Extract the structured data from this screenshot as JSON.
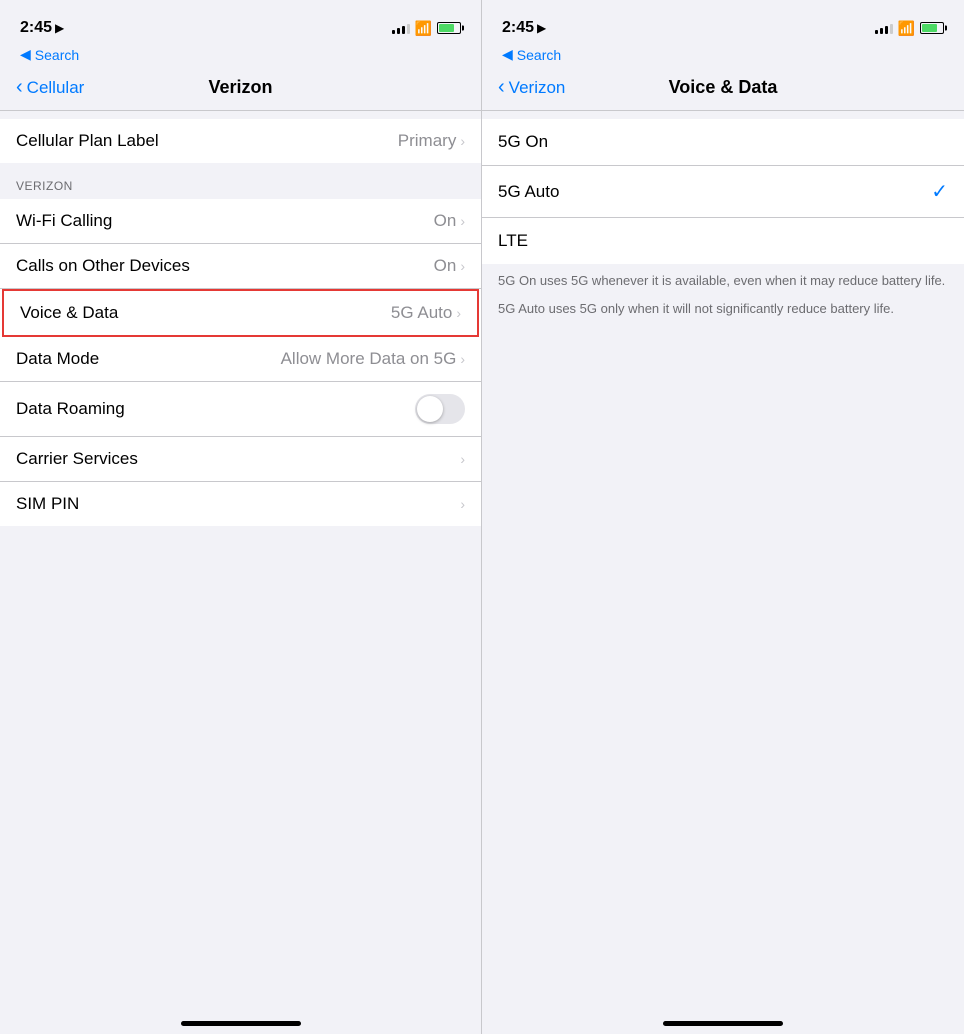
{
  "left_panel": {
    "status_bar": {
      "time": "2:45",
      "location_icon": "▶",
      "signal_bars": [
        3,
        5,
        7,
        9,
        11
      ],
      "wifi": "wifi",
      "battery_percent": 75
    },
    "search_label": "Search",
    "nav_back_label": "Cellular",
    "nav_title": "Verizon",
    "cellular_plan_label": "Cellular Plan Label",
    "cellular_plan_value": "Primary",
    "section_header": "VERIZON",
    "items": [
      {
        "label": "Wi-Fi Calling",
        "value": "On",
        "has_chevron": true
      },
      {
        "label": "Calls on Other Devices",
        "value": "On",
        "has_chevron": true
      },
      {
        "label": "Voice & Data",
        "value": "5G Auto",
        "has_chevron": true,
        "highlighted": true
      },
      {
        "label": "Data Mode",
        "value": "Allow More Data on 5G",
        "has_chevron": true
      },
      {
        "label": "Data Roaming",
        "value": "",
        "has_toggle": true
      },
      {
        "label": "Carrier Services",
        "value": "",
        "has_chevron": true
      },
      {
        "label": "SIM PIN",
        "value": "",
        "has_chevron": true
      }
    ],
    "home_bar": "home-bar"
  },
  "right_panel": {
    "status_bar": {
      "time": "2:45",
      "location_icon": "▶"
    },
    "search_label": "Search",
    "nav_back_label": "Verizon",
    "nav_title": "Voice & Data",
    "options": [
      {
        "label": "5G On",
        "selected": false
      },
      {
        "label": "5G Auto",
        "selected": true
      },
      {
        "label": "LTE",
        "selected": false
      }
    ],
    "info_blocks": [
      "5G On uses 5G whenever it is available, even when it may reduce battery life.",
      "5G Auto uses 5G only when it will not significantly reduce battery life."
    ],
    "home_bar": "home-bar"
  }
}
